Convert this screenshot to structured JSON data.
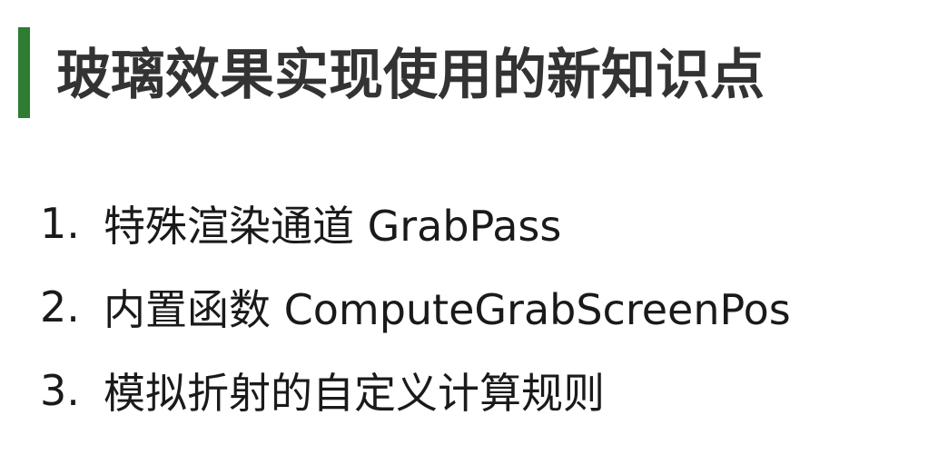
{
  "heading": {
    "title": "玻璃效果实现使用的新知识点",
    "accent_color": "#2e7d32"
  },
  "list": {
    "items": [
      {
        "number": "1.",
        "text": "特殊渲染通道 GrabPass"
      },
      {
        "number": "2.",
        "text": "内置函数 ComputeGrabScreenPos"
      },
      {
        "number": "3.",
        "text": "模拟折射的自定义计算规则"
      }
    ]
  }
}
